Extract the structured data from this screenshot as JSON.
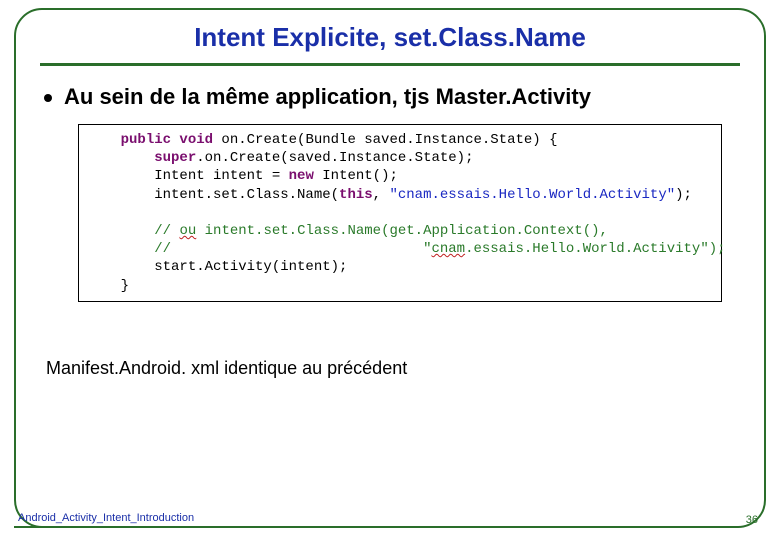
{
  "title": "Intent Explicite, set.Class.Name",
  "bullet": "Au sein de la même application, tjs Master.Activity",
  "code": {
    "l1a": "public void",
    "l1b": " on.Create(Bundle saved.Instance.State) {",
    "l2a": "super",
    "l2b": ".on.Create(saved.Instance.State);",
    "l3a": "        Intent intent = ",
    "l3b": "new",
    "l3c": " Intent();",
    "l4a": "        intent.set.Class.Name(",
    "l4b": "this",
    "l4c": ", ",
    "l4d": "\"cnam.essais.Hello.World.Activity\"",
    "l4e": ");",
    "l5a": "// ",
    "l5b": "ou",
    "l5c": " intent.set.Class.Name(get.Application.Context(),",
    "l6a": "//                              \"",
    "l6b": "cnam",
    "l6c": ".essais.Hello.World.Activity\");",
    "l7": "        start.Activity(intent);",
    "l8": "    }"
  },
  "caption": "Manifest.Android. xml identique au précédent",
  "footer": "Android_Activity_Intent_Introduction",
  "page": "36"
}
